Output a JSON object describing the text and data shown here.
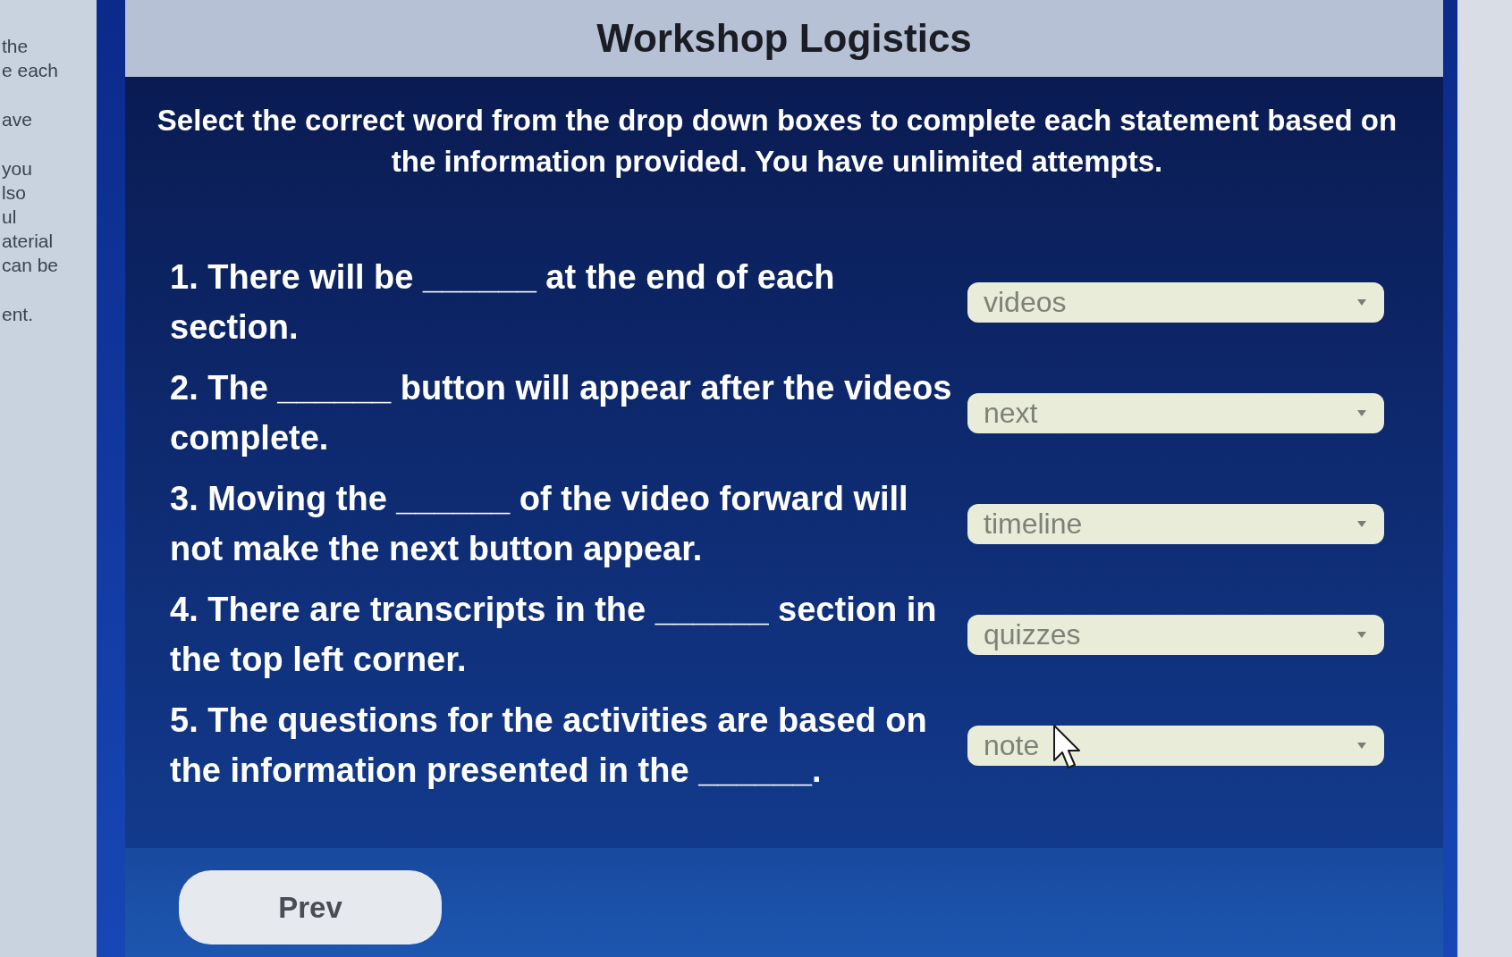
{
  "sidebar_fragments": [
    {
      "lines": [
        "the",
        "e each"
      ]
    },
    {
      "lines": [
        "ave"
      ]
    },
    {
      "lines": [
        "you",
        "lso",
        "ul",
        "aterial",
        "can be"
      ]
    },
    {
      "lines": [
        "ent."
      ]
    }
  ],
  "header": {
    "title": "Workshop Logistics"
  },
  "instructions": "Select the correct word from the drop down boxes to complete each statement based on the information provided. You have unlimited attempts.",
  "questions": [
    {
      "text": "1. There will be ______ at the end of each section.",
      "answer": "videos"
    },
    {
      "text": "2. The ______ button will appear after the videos complete.",
      "answer": "next"
    },
    {
      "text": "3. Moving the ______ of the video forward will not make the next button appear.",
      "answer": "timeline"
    },
    {
      "text": "4. There are transcripts in the ______ section in the top left corner.",
      "answer": "quizzes"
    },
    {
      "text": "5. The questions for the activities are based on the information presented in the ______.",
      "answer": "note"
    }
  ],
  "prev_button": "Prev"
}
